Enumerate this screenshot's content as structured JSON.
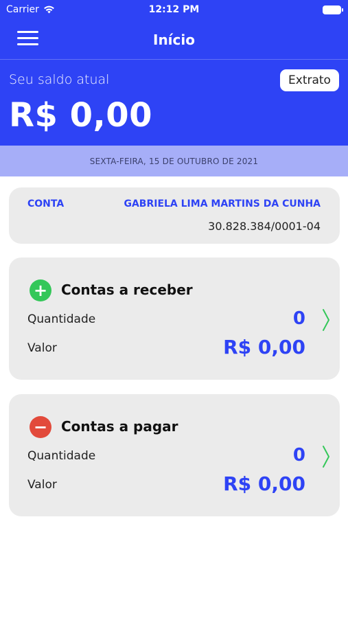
{
  "status_bar": {
    "carrier": "Carrier",
    "time": "12:12 PM"
  },
  "nav": {
    "title": "Início",
    "menu_icon": "hamburger-menu-icon"
  },
  "balance": {
    "label": "Seu saldo atual",
    "value": "R$ 0,00",
    "extrato_button": "Extrato"
  },
  "date": "SEXTA-FEIRA, 15 DE OUTUBRO DE 2021",
  "account": {
    "label": "CONTA",
    "name": "GABRIELA LIMA MARTINS DA CUNHA",
    "document": "30.828.384/0001-04"
  },
  "receivables": {
    "icon": "plus-circle-icon",
    "title": "Contas a receber",
    "quantity_label": "Quantidade",
    "quantity": "0",
    "value_label": "Valor",
    "value": "R$ 0,00"
  },
  "payables": {
    "icon": "minus-circle-icon",
    "title": "Contas a pagar",
    "quantity_label": "Quantidade",
    "quantity": "0",
    "value_label": "Valor",
    "value": "R$ 0,00"
  },
  "colors": {
    "primary": "#2e43f5",
    "date_strip": "#a6aef8",
    "card_bg": "#ebebeb",
    "positive": "#34c759",
    "negative": "#e24a3b"
  }
}
